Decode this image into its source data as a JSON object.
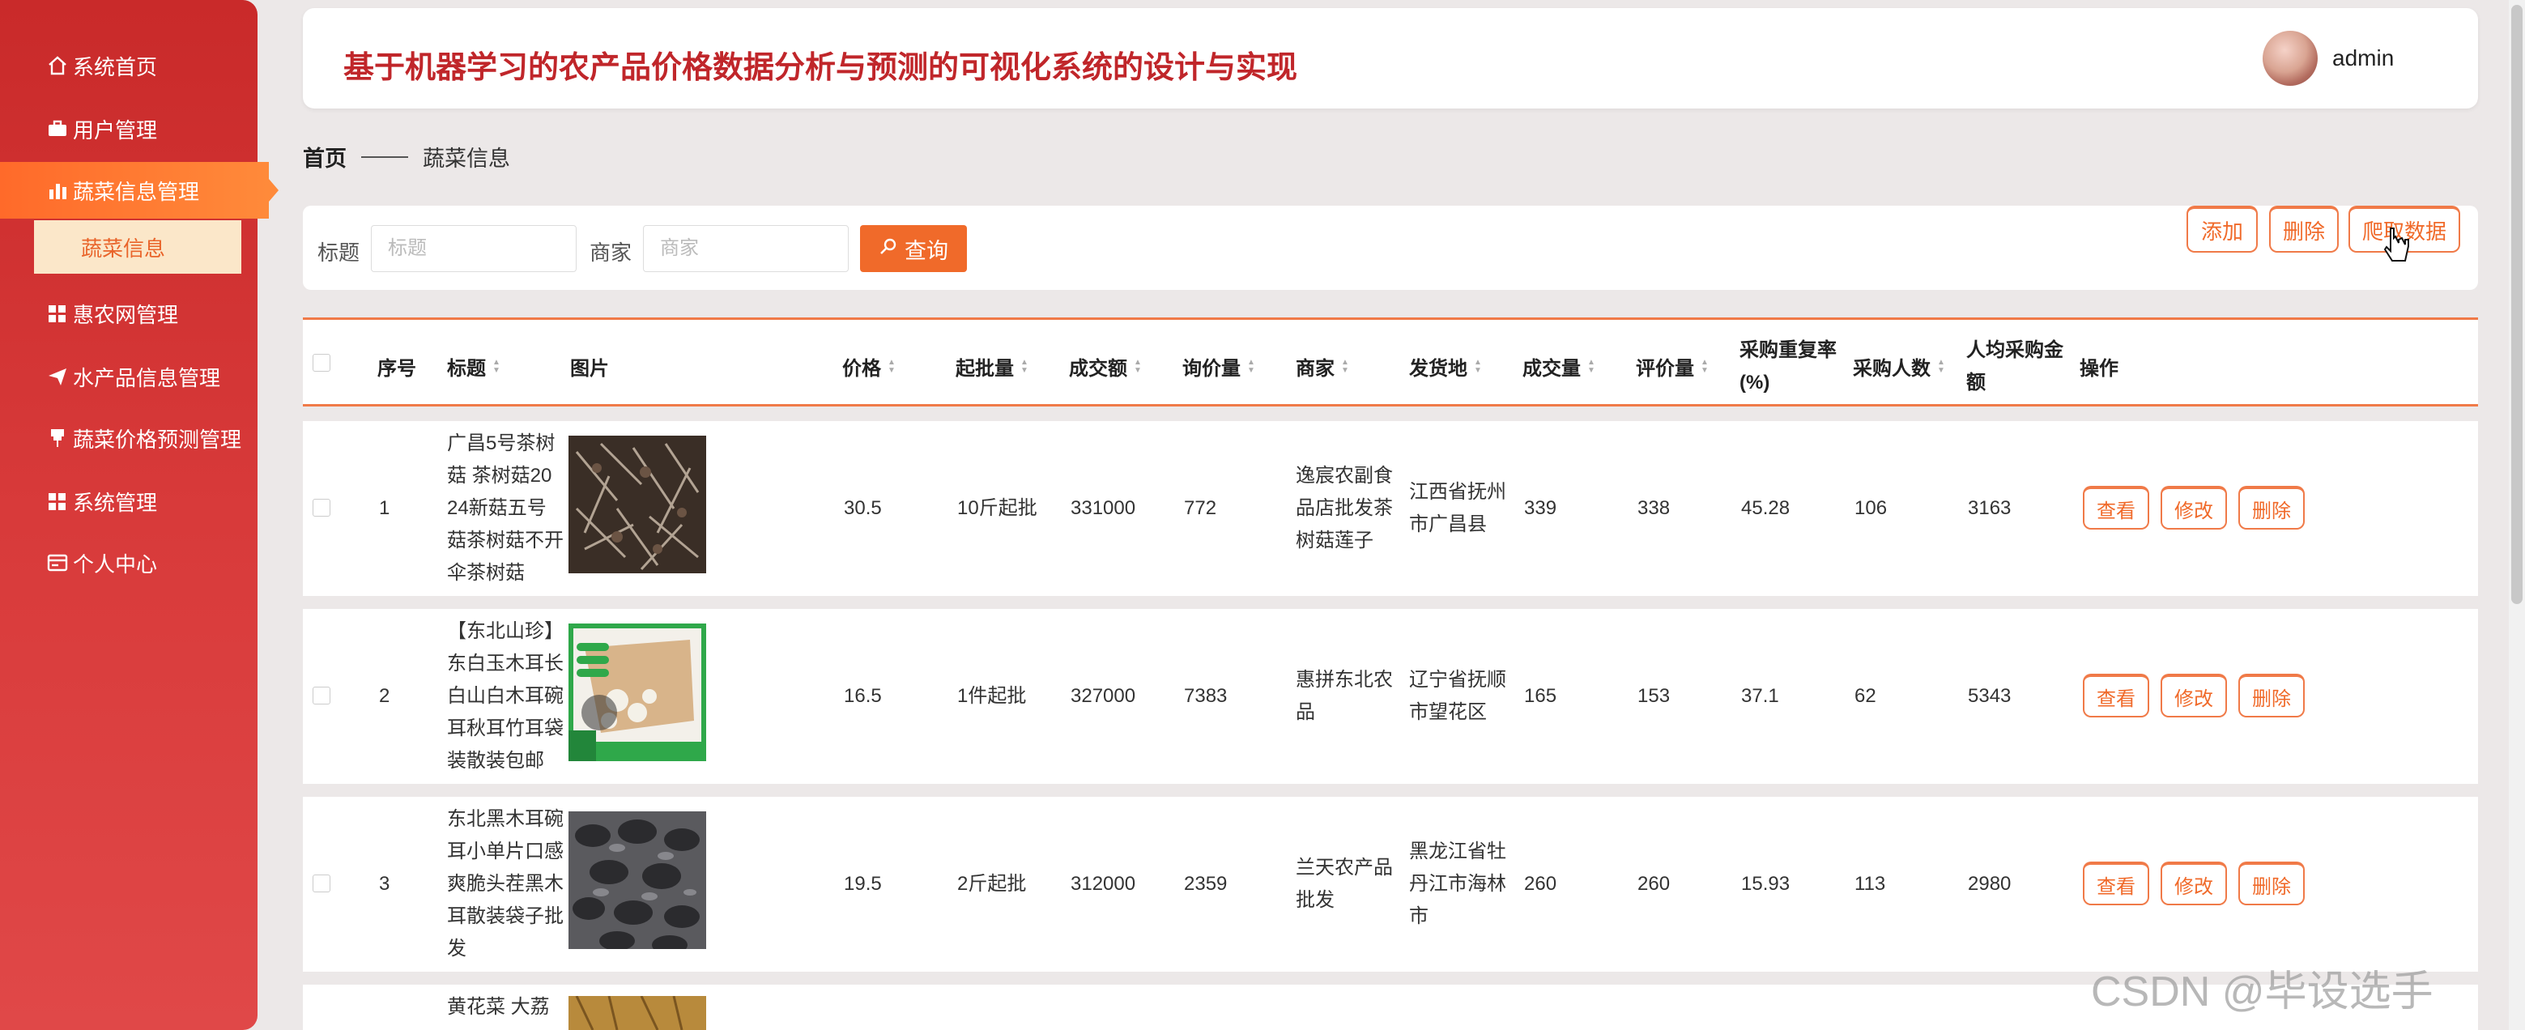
{
  "sidebar": {
    "items": [
      {
        "label": "系统首页",
        "icon": "home-icon"
      },
      {
        "label": "用户管理",
        "icon": "briefcase-icon"
      },
      {
        "label": "蔬菜信息管理",
        "icon": "bar-chart-icon"
      },
      {
        "label": "惠农网管理",
        "icon": "grid-icon"
      },
      {
        "label": "水产品信息管理",
        "icon": "send-icon"
      },
      {
        "label": "蔬菜价格预测管理",
        "icon": "pin-icon"
      },
      {
        "label": "系统管理",
        "icon": "grid-icon"
      },
      {
        "label": "个人中心",
        "icon": "card-icon"
      }
    ],
    "sub_item": "蔬菜信息"
  },
  "header": {
    "title": "基于机器学习的农产品价格数据分析与预测的可视化系统的设计与实现",
    "username": "admin"
  },
  "breadcrumb": {
    "home": "首页",
    "current": "蔬菜信息"
  },
  "search": {
    "title_label": "标题",
    "title_placeholder": "标题",
    "merchant_label": "商家",
    "merchant_placeholder": "商家",
    "query_label": "查询"
  },
  "toolbar": {
    "add": "添加",
    "delete": "删除",
    "crawl": "爬取数据"
  },
  "table": {
    "columns": [
      "序号",
      "标题",
      "图片",
      "价格",
      "起批量",
      "成交额",
      "询价量",
      "商家",
      "发货地",
      "成交量",
      "评价量",
      "采购重复率(%)",
      "采购人数",
      "人均采购金额",
      "操作"
    ],
    "col_repeat_rate_1": "采购重复率",
    "col_repeat_rate_2": "(%)",
    "col_avg_1": "人均采购金",
    "col_avg_2": "额",
    "actions": {
      "view": "查看",
      "edit": "修改",
      "delete": "删除"
    },
    "rows": [
      {
        "index": "1",
        "title_lines": [
          "广昌5号茶树",
          "菇 茶树菇20",
          "24新菇五号",
          "菇茶树菇不开",
          "伞茶树菇"
        ],
        "price": "30.5",
        "min_batch": "10斤起批",
        "turnover": "331000",
        "inquiries": "772",
        "merchant_lines": [
          "逸宸农副食",
          "品店批发茶",
          "树菇莲子"
        ],
        "origin_lines": [
          "江西省抚州",
          "市广昌县"
        ],
        "volume": "339",
        "reviews": "338",
        "repeat_rate": "45.28",
        "buyers": "106",
        "avg_amount": "3163"
      },
      {
        "index": "2",
        "title_lines": [
          "【东北山珍】",
          "东白玉木耳长",
          "白山白木耳碗",
          "耳秋耳竹耳袋",
          "装散装包邮"
        ],
        "price": "16.5",
        "min_batch": "1件起批",
        "turnover": "327000",
        "inquiries": "7383",
        "merchant_lines": [
          "惠拼东北农",
          "品"
        ],
        "origin_lines": [
          "辽宁省抚顺",
          "市望花区"
        ],
        "volume": "165",
        "reviews": "153",
        "repeat_rate": "37.1",
        "buyers": "62",
        "avg_amount": "5343"
      },
      {
        "index": "3",
        "title_lines": [
          "东北黑木耳碗",
          "耳小单片口感",
          "爽脆头茬黑木",
          "耳散装袋子批",
          "发"
        ],
        "price": "19.5",
        "min_batch": "2斤起批",
        "turnover": "312000",
        "inquiries": "2359",
        "merchant_lines": [
          "兰天农产品",
          "批发"
        ],
        "origin_lines": [
          "黑龙江省牡",
          "丹江市海林",
          "市"
        ],
        "volume": "260",
        "reviews": "260",
        "repeat_rate": "15.93",
        "buyers": "113",
        "avg_amount": "2980"
      },
      {
        "title_lines": [
          "黄花菜 大荔"
        ]
      }
    ]
  },
  "watermark": "CSDN @毕设选手",
  "colors": {
    "sidebar": "#d83a3a",
    "accent": "#f06a2a",
    "title": "#c0262a"
  }
}
